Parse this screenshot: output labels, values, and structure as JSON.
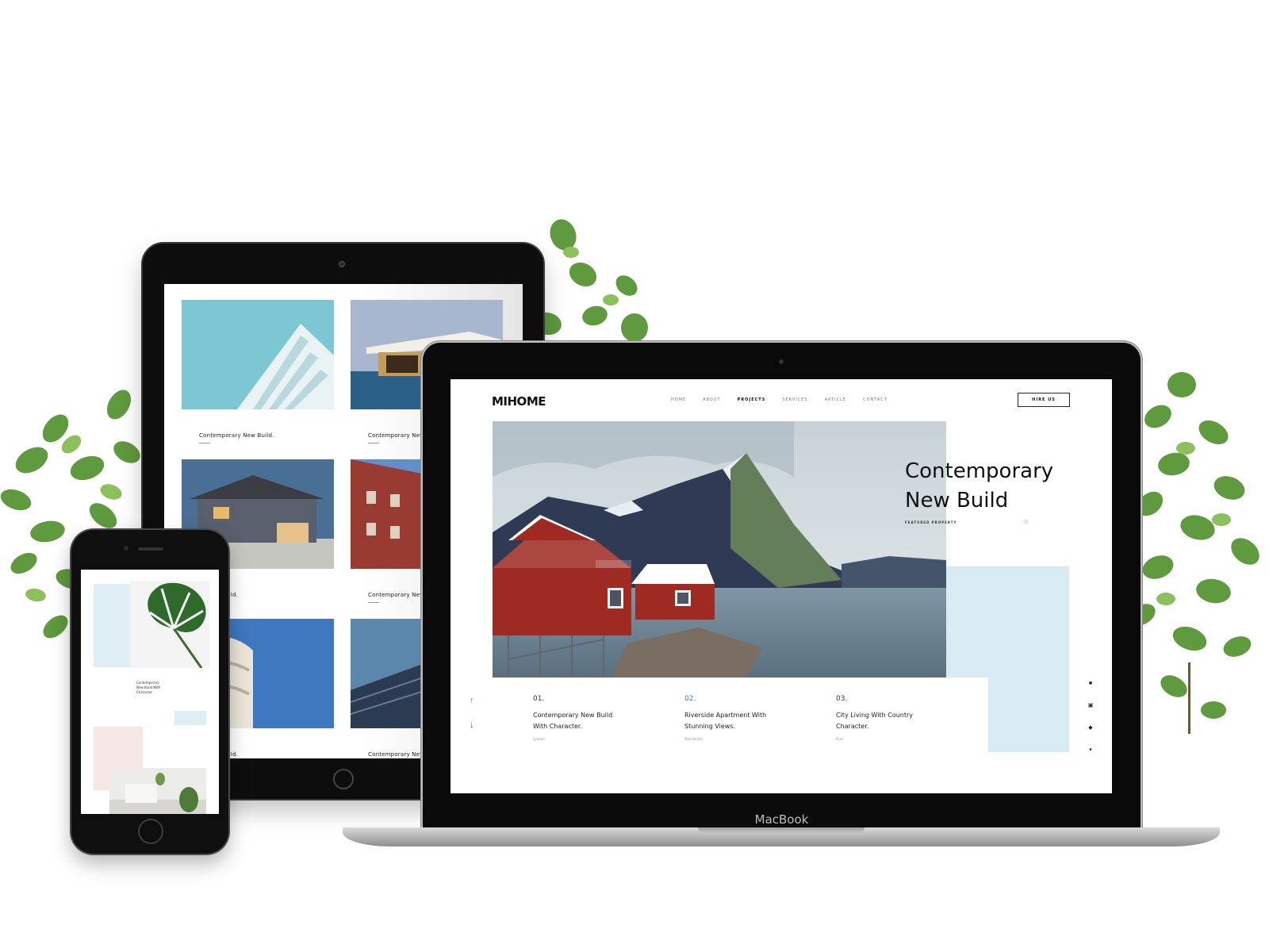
{
  "laptop": {
    "brand": "MacBook",
    "site": {
      "logo": "MIHOME",
      "nav": [
        "HOME",
        "ABOUT",
        "PROJECTS",
        "SERVICES",
        "ARTICLE",
        "CONTACT"
      ],
      "nav_active": "PROJECTS",
      "hire_button": "HIRE US",
      "hero_title_line1": "Contemporary",
      "hero_title_line2": "New Build",
      "hero_subtitle": "FEATURED PROPERTY",
      "features": [
        {
          "num": "01.",
          "title_line1": "Contemporary New Build",
          "title_line2": "With Character.",
          "location": "London"
        },
        {
          "num": "02.",
          "title_line1": "Riverside Apartment With",
          "title_line2": "Stunning Views.",
          "location": "Manchester"
        },
        {
          "num": "03.",
          "title_line1": "City Living With Country",
          "title_line2": "Character.",
          "location": "Paris"
        }
      ],
      "social_icons": [
        "facebook-icon",
        "linkedin-icon",
        "instagram-icon",
        "twitter-icon"
      ]
    }
  },
  "tablet": {
    "cards": [
      {
        "caption": "Contemporary New Build."
      },
      {
        "caption": "Contemporary New"
      },
      {
        "caption": "ry New Build."
      },
      {
        "caption": "Contemporary New"
      },
      {
        "caption": "ry New Build."
      },
      {
        "caption": "Contemporary New"
      }
    ]
  },
  "phone": {
    "text_line1": "Contemporary",
    "text_line2": "New Build With",
    "text_line3": "Character."
  },
  "colors": {
    "accent_blue": "#3a7bd5",
    "pale_blue": "#d8ebf3",
    "house_red": "#9e2a22",
    "leaf_green": "#5f9a3e"
  }
}
